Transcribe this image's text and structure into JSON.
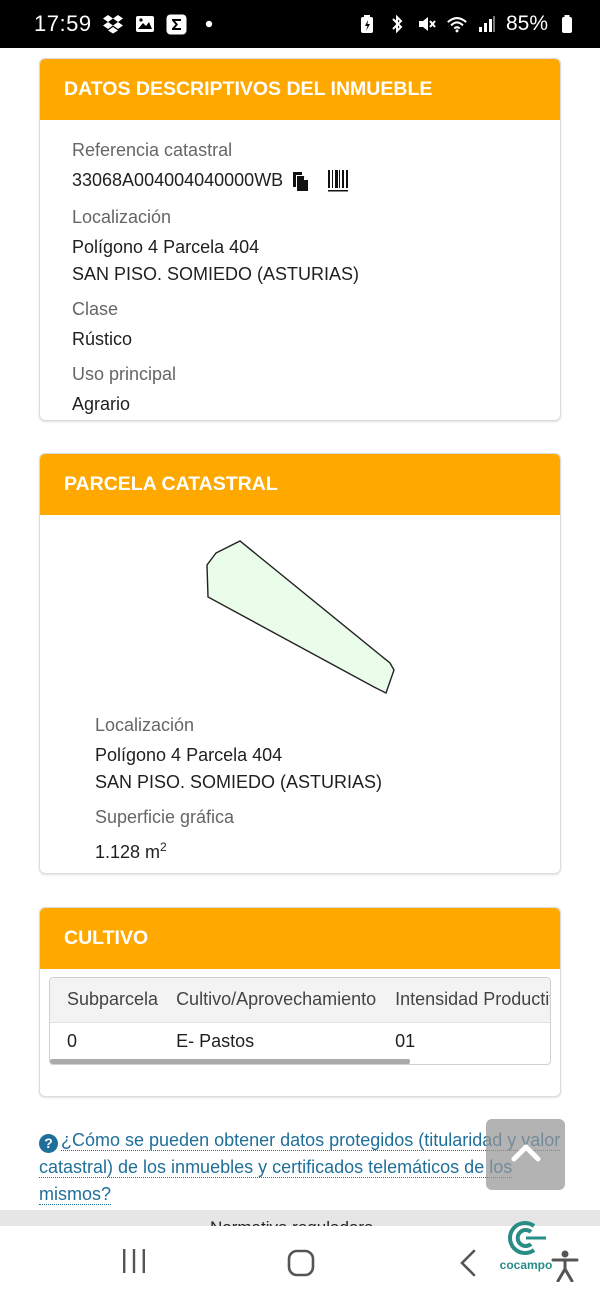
{
  "status_bar": {
    "time": "17:59",
    "battery": "85%",
    "left_icons": [
      "dropbox-icon",
      "gallery-icon",
      "sigma-app-icon",
      "dot-icon"
    ],
    "right_icons": [
      "battery-saver-icon",
      "bluetooth-icon",
      "mute-icon",
      "wifi-icon",
      "signal-icon",
      "battery-icon"
    ]
  },
  "datos": {
    "title": "DATOS DESCRIPTIVOS DEL INMUEBLE",
    "ref_label": "Referencia catastral",
    "ref_value": "33068A004004040000WB",
    "loc_label": "Localización",
    "loc_line1": "Polígono 4 Parcela 404",
    "loc_line2": "SAN PISO. SOMIEDO (ASTURIAS)",
    "clase_label": "Clase",
    "clase_value": "Rústico",
    "uso_label": "Uso principal",
    "uso_value": "Agrario"
  },
  "parcela": {
    "title": "PARCELA CATASTRAL",
    "loc_label": "Localización",
    "loc_line1": "Polígono 4 Parcela 404",
    "loc_line2": "SAN PISO. SOMIEDO (ASTURIAS)",
    "sup_label": "Superficie gráfica",
    "sup_value": "1.128 m",
    "sup_unit_exp": "2",
    "shape_fill": "#eafcea",
    "shape_stroke": "#222222"
  },
  "cultivo": {
    "title": "CULTIVO",
    "columns": [
      "Subparcela",
      "Cultivo/Aprovechamiento",
      "Intensidad Productiva"
    ],
    "rows": [
      [
        "0",
        "E- Pastos",
        "01"
      ]
    ]
  },
  "help": {
    "link_text": "¿Cómo se pueden obtener datos protegidos (titularidad y valor catastral) de los inmuebles y certificados telemáticos de los mismos?"
  },
  "footer": {
    "text": "Normativa reguladora"
  },
  "nav": {
    "logo_text": "cocampo"
  },
  "colors": {
    "accent": "#ffa800",
    "link": "#1f6f9a"
  }
}
